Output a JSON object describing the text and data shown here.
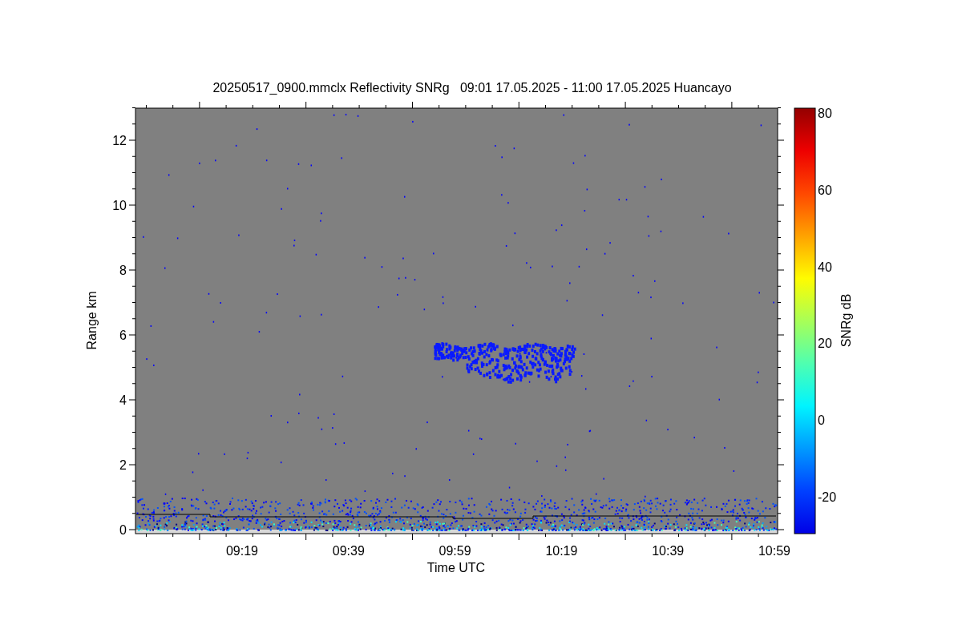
{
  "title": "20250517_0900.mmclx Reflectivity SNRg   09:01 17.05.2025 - 11:00 17.05.2025 Huancayo",
  "y_axis": {
    "label": "Range km",
    "ticks": [
      "12",
      "10",
      "8",
      "6",
      "4",
      "2",
      "0"
    ]
  },
  "x_axis": {
    "label": "Time UTC",
    "ticks": [
      "09:19",
      "09:39",
      "09:59",
      "10:19",
      "10:39",
      "10:59"
    ]
  },
  "colorbar": {
    "label": "SNRg dB",
    "ticks": [
      "80",
      "60",
      "40",
      "20",
      "0",
      "-20"
    ]
  }
}
